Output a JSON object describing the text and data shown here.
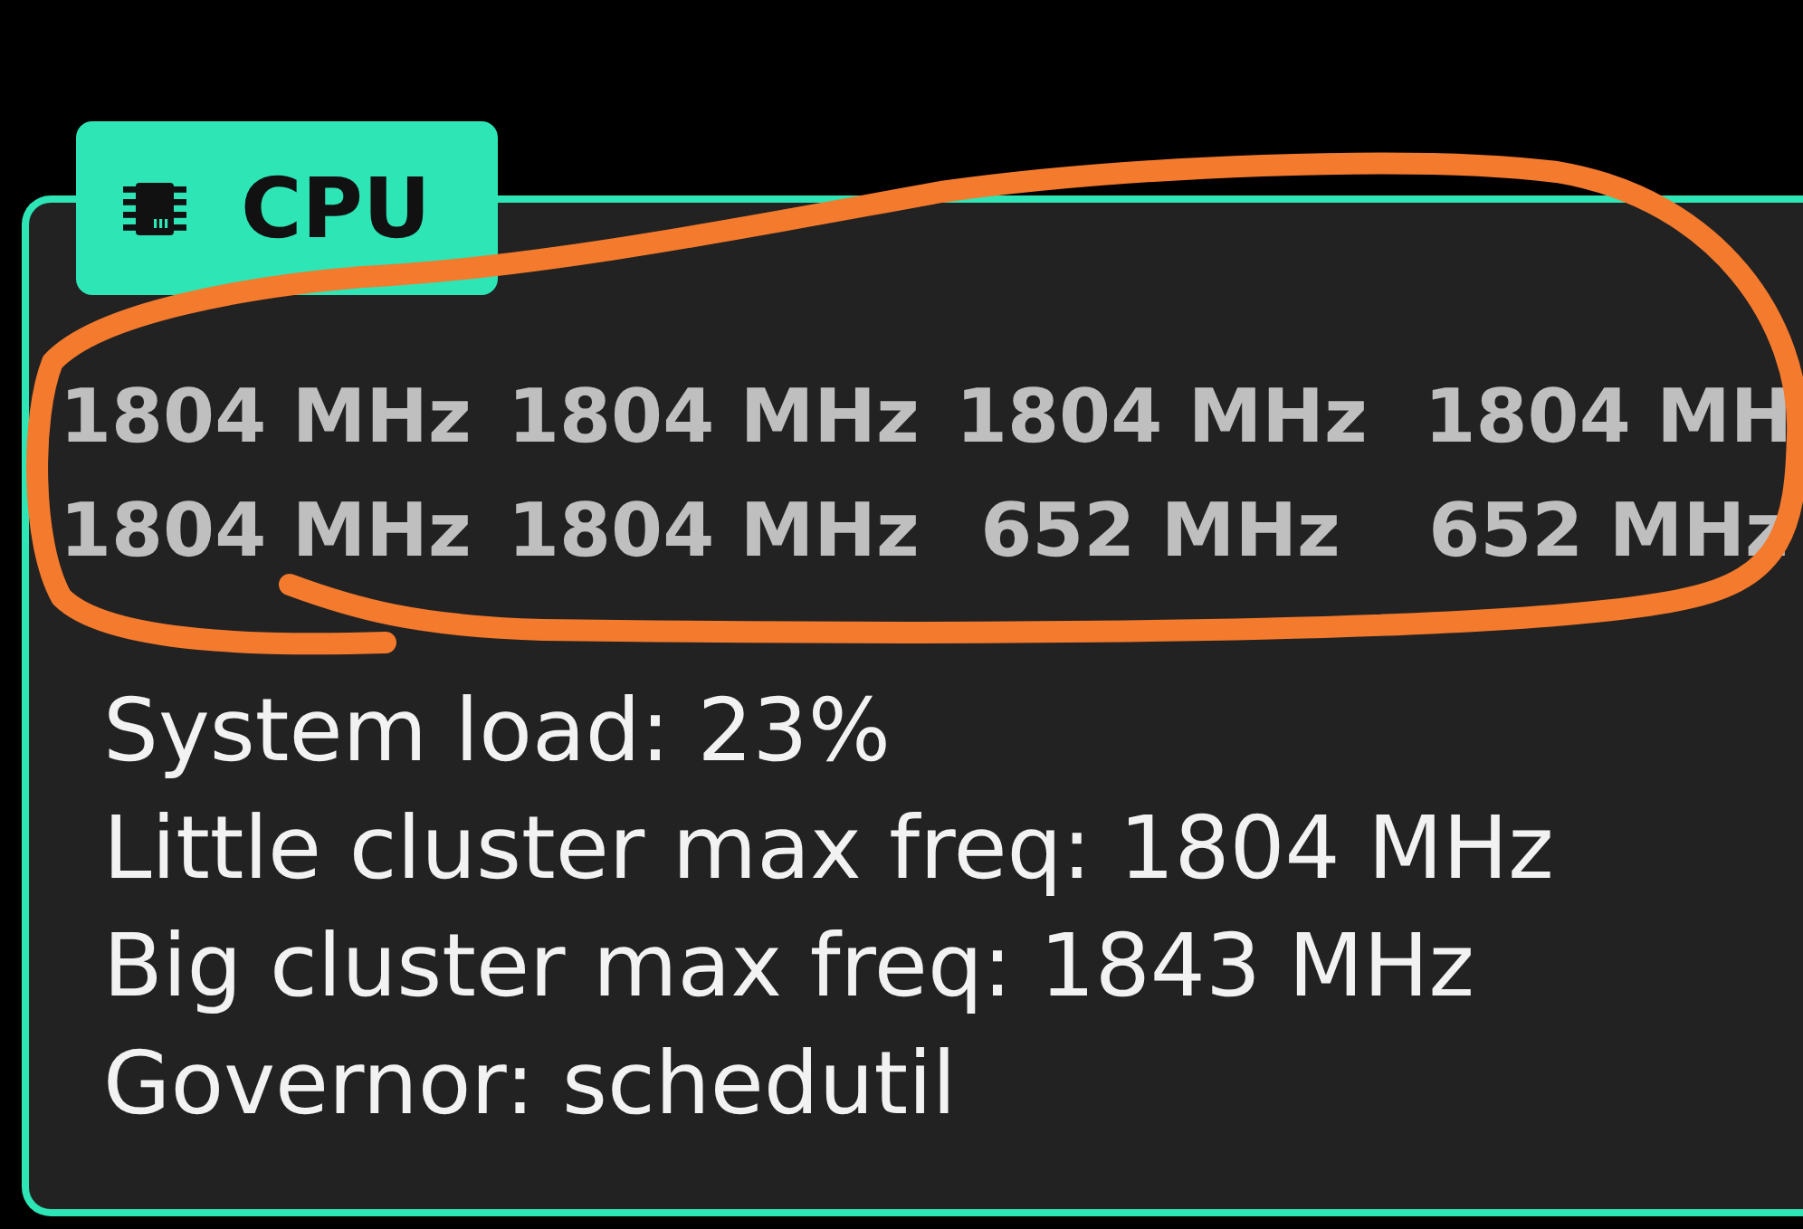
{
  "panel": {
    "title": "CPU",
    "frequency_rows": [
      [
        "1804 MHz",
        "1804 MHz",
        "1804 MHz",
        "1804 MH"
      ],
      [
        "1804 MHz",
        "1804 MHz",
        "652 MHz",
        "652 MHz"
      ]
    ],
    "stats": [
      "System load: 23%",
      "Little cluster max freq: 1804 MHz",
      "Big cluster max freq: 1843 MHz",
      "Governor: schedutil"
    ]
  }
}
